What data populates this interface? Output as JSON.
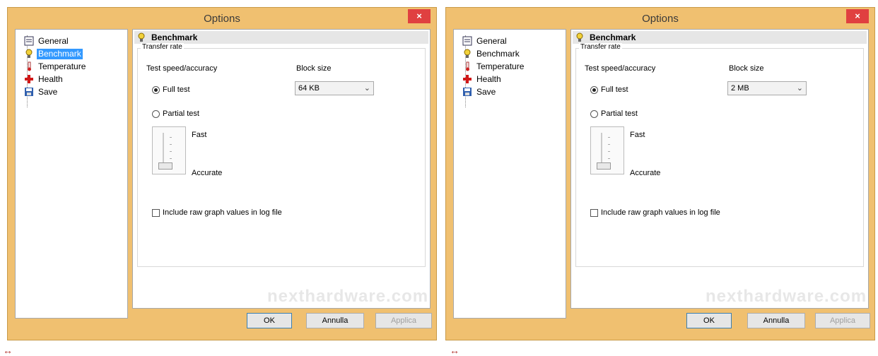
{
  "windows": [
    {
      "title": "Options",
      "close_glyph": "×",
      "tree": [
        {
          "label": "General",
          "icon": "general-icon"
        },
        {
          "label": "Benchmark",
          "icon": "bulb-icon",
          "selected": true
        },
        {
          "label": "Temperature",
          "icon": "thermometer-icon"
        },
        {
          "label": "Health",
          "icon": "health-cross-icon"
        },
        {
          "label": "Save",
          "icon": "floppy-icon"
        }
      ],
      "panel": {
        "header": "Benchmark",
        "group_label": "Transfer rate",
        "speed_label": "Test speed/accuracy",
        "block_label": "Block size",
        "block_value": "64 KB",
        "full_test": "Full test",
        "partial_test": "Partial test",
        "fast_label": "Fast",
        "accurate_label": "Accurate",
        "raw_graph_label": "Include raw graph values in log file",
        "watermark": "nexthardware.com"
      },
      "buttons": {
        "ok": "OK",
        "cancel": "Annulla",
        "apply": "Applica"
      }
    },
    {
      "title": "Options",
      "close_glyph": "×",
      "tree": [
        {
          "label": "General",
          "icon": "general-icon"
        },
        {
          "label": "Benchmark",
          "icon": "bulb-icon"
        },
        {
          "label": "Temperature",
          "icon": "thermometer-icon"
        },
        {
          "label": "Health",
          "icon": "health-cross-icon"
        },
        {
          "label": "Save",
          "icon": "floppy-icon"
        }
      ],
      "panel": {
        "header": "Benchmark",
        "group_label": "Transfer rate",
        "speed_label": "Test speed/accuracy",
        "block_label": "Block size",
        "block_value": "2 MB",
        "full_test": "Full test",
        "partial_test": "Partial test",
        "fast_label": "Fast",
        "accurate_label": "Accurate",
        "raw_graph_label": "Include raw graph values in log file",
        "watermark": "nexthardware.com"
      },
      "buttons": {
        "ok": "OK",
        "cancel": "Annulla",
        "apply": "Applica"
      }
    }
  ],
  "resize_glyph": "↔",
  "colors": {
    "window_frame": "#f0c070",
    "close": "#e04040",
    "selection": "#3399ff"
  }
}
